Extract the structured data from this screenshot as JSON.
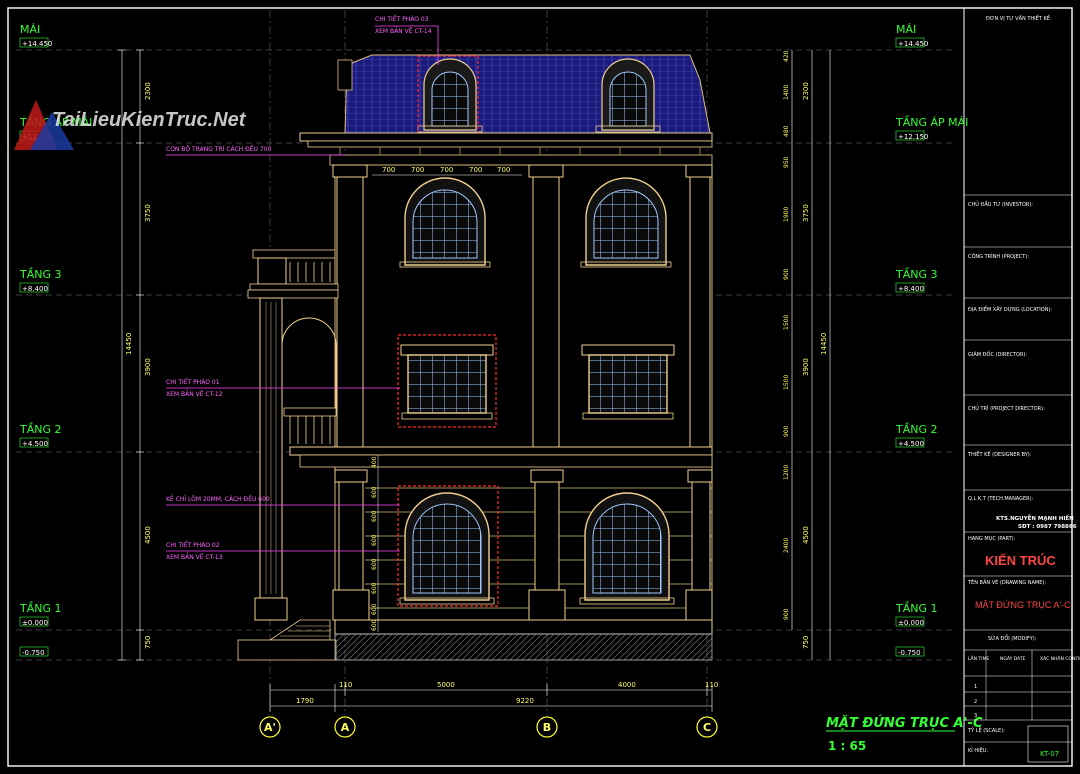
{
  "watermark": "TaiLieuKienTruc.Net",
  "levels_left": [
    {
      "name": "MÁI",
      "value": "+14.450"
    },
    {
      "name": "TẦNG ÁP MÁI",
      "value": "+12.150"
    },
    {
      "name": "TẦNG 3",
      "value": "+8.400"
    },
    {
      "name": "TẦNG 2",
      "value": "+4.500"
    },
    {
      "name": "TẦNG 1",
      "value": "±0.000"
    },
    {
      "name": "",
      "value": "-0.750"
    }
  ],
  "levels_right": [
    {
      "name": "MÁI",
      "value": "+14.450"
    },
    {
      "name": "TẦNG ÁP MÁI",
      "value": "+12.150"
    },
    {
      "name": "TẦNG 3",
      "value": "+8.400"
    },
    {
      "name": "TẦNG 2",
      "value": "+4.500"
    },
    {
      "name": "TẦNG 1",
      "value": "±0.000"
    },
    {
      "name": "",
      "value": "-0.750"
    }
  ],
  "dims_left_outer": [
    "2300",
    "3750",
    "3900",
    "4500",
    "750"
  ],
  "dims_left_total": "14450",
  "dims_right_inner": [
    "420",
    "1400",
    "480",
    "950",
    "1900",
    "900",
    "1500",
    "1500",
    "900",
    "1200",
    "2400",
    "900"
  ],
  "dims_right_outer": [
    "2300",
    "3750",
    "3900",
    "4500",
    "750"
  ],
  "dims_right_total": "14450",
  "dims_top": [
    "700",
    "700",
    "700",
    "700",
    "700"
  ],
  "dims_stack": [
    "400",
    "600",
    "600",
    "600",
    "600",
    "600",
    "600",
    "600"
  ],
  "dims_bottom": [
    "110",
    "5000",
    "4000",
    "110"
  ],
  "dims_bottom2": [
    "1790",
    "9220"
  ],
  "axes": [
    "A'",
    "A",
    "B",
    "C"
  ],
  "notes": [
    {
      "l1": "CHI TIẾT PHÀO 03",
      "l2": "XEM BẢN VẼ CT-14"
    },
    {
      "l1": "CON BỘ TRANG TRÍ CÁCH ĐỀU 700",
      "l2": ""
    },
    {
      "l1": "CHI TIẾT PHÀO 01",
      "l2": "XEM BẢN VẼ CT-12"
    },
    {
      "l1": "KẺ CHỈ LÕM 20MM, CÁCH ĐỀU 600",
      "l2": ""
    },
    {
      "l1": "CHI TIẾT PHÀO 02",
      "l2": "XEM BẢN VẼ CT-13"
    }
  ],
  "title": {
    "name": "MẶT ĐỨNG TRỤC A'-C",
    "scale": "1 : 65"
  },
  "titleblock": {
    "designer_unit": "ĐƠN VỊ TƯ VẤN THIẾT KẾ",
    "investor": "CHỦ ĐẦU TƯ (INVESTOR):",
    "project": "CÔNG TRÌNH (PROJECT):",
    "location": "ĐỊA ĐIỂM XÂY DỰNG (LOCATION):",
    "director": "GIÁM ĐỐC (DIRECTOR):",
    "project_director": "CHỦ TRÌ (PROJECT DIRECTOR):",
    "designer": "THIẾT KẾ (DESIGNER BY):",
    "manager": "Q.L K.T (TECH.MANAGER):",
    "author": "KTS.NGUYỄN MẠNH HIẾN",
    "phone": "SĐT : 0987 798866",
    "part_label": "HẠNG MỤC (PART):",
    "part": "KIẾN TRÚC",
    "drawing_label": "TÊN BẢN VẼ (DRAWING NAME):",
    "drawing": "MẶT ĐỨNG TRỤC A'-C",
    "modify_label": "SỬA ĐỔI (MODIFY):",
    "col1": "LẦN\nTIME",
    "col2": "NGÀY\nDATE",
    "col3": "XÁC NHẬN\nCONFIRM",
    "rows": [
      "1",
      "2",
      "3"
    ],
    "scale_label": "TỶ LỆ (SCALE):",
    "sheet_label": "KÍ HIỆU:",
    "sheet_code": "KT-07"
  }
}
